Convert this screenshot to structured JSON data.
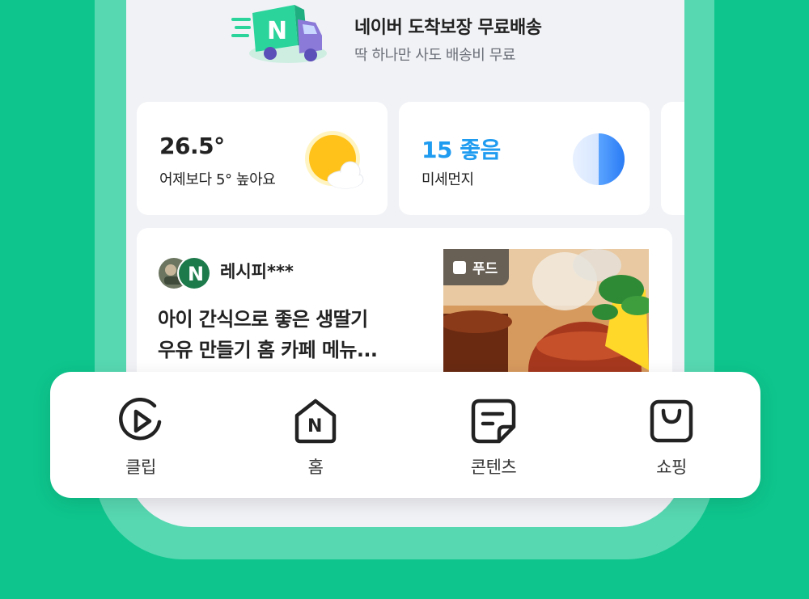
{
  "banner": {
    "title": "네이버 도착보장 무료배송",
    "subtitle": "딱 하나만 사도 배송비 무료",
    "icon": "delivery-truck-icon"
  },
  "widgets": {
    "weather": {
      "value": "26.5°",
      "label": "어제보다 5° 높아요",
      "icon": "sun-cloud-icon"
    },
    "dust": {
      "value": "15 좋음",
      "label": "미세먼지",
      "value_color": "#1f9bf0",
      "icon": "dust-gauge-icon"
    }
  },
  "feed": {
    "author": "레시피***",
    "headline_line1": "아이 간식으로 좋은 생딸기",
    "headline_line2": "우유 만들기 홈 카페 메뉴...",
    "tag": "푸드"
  },
  "bottom_nav": {
    "items": [
      {
        "label": "클립",
        "icon": "clip-play-icon"
      },
      {
        "label": "홈",
        "icon": "home-n-icon"
      },
      {
        "label": "콘텐츠",
        "icon": "content-note-icon"
      },
      {
        "label": "쇼핑",
        "icon": "shopping-bag-icon"
      }
    ]
  },
  "colors": {
    "brand_green": "#0ec68d",
    "frame_green": "#57d8b1",
    "naver_green": "#03c75a"
  }
}
